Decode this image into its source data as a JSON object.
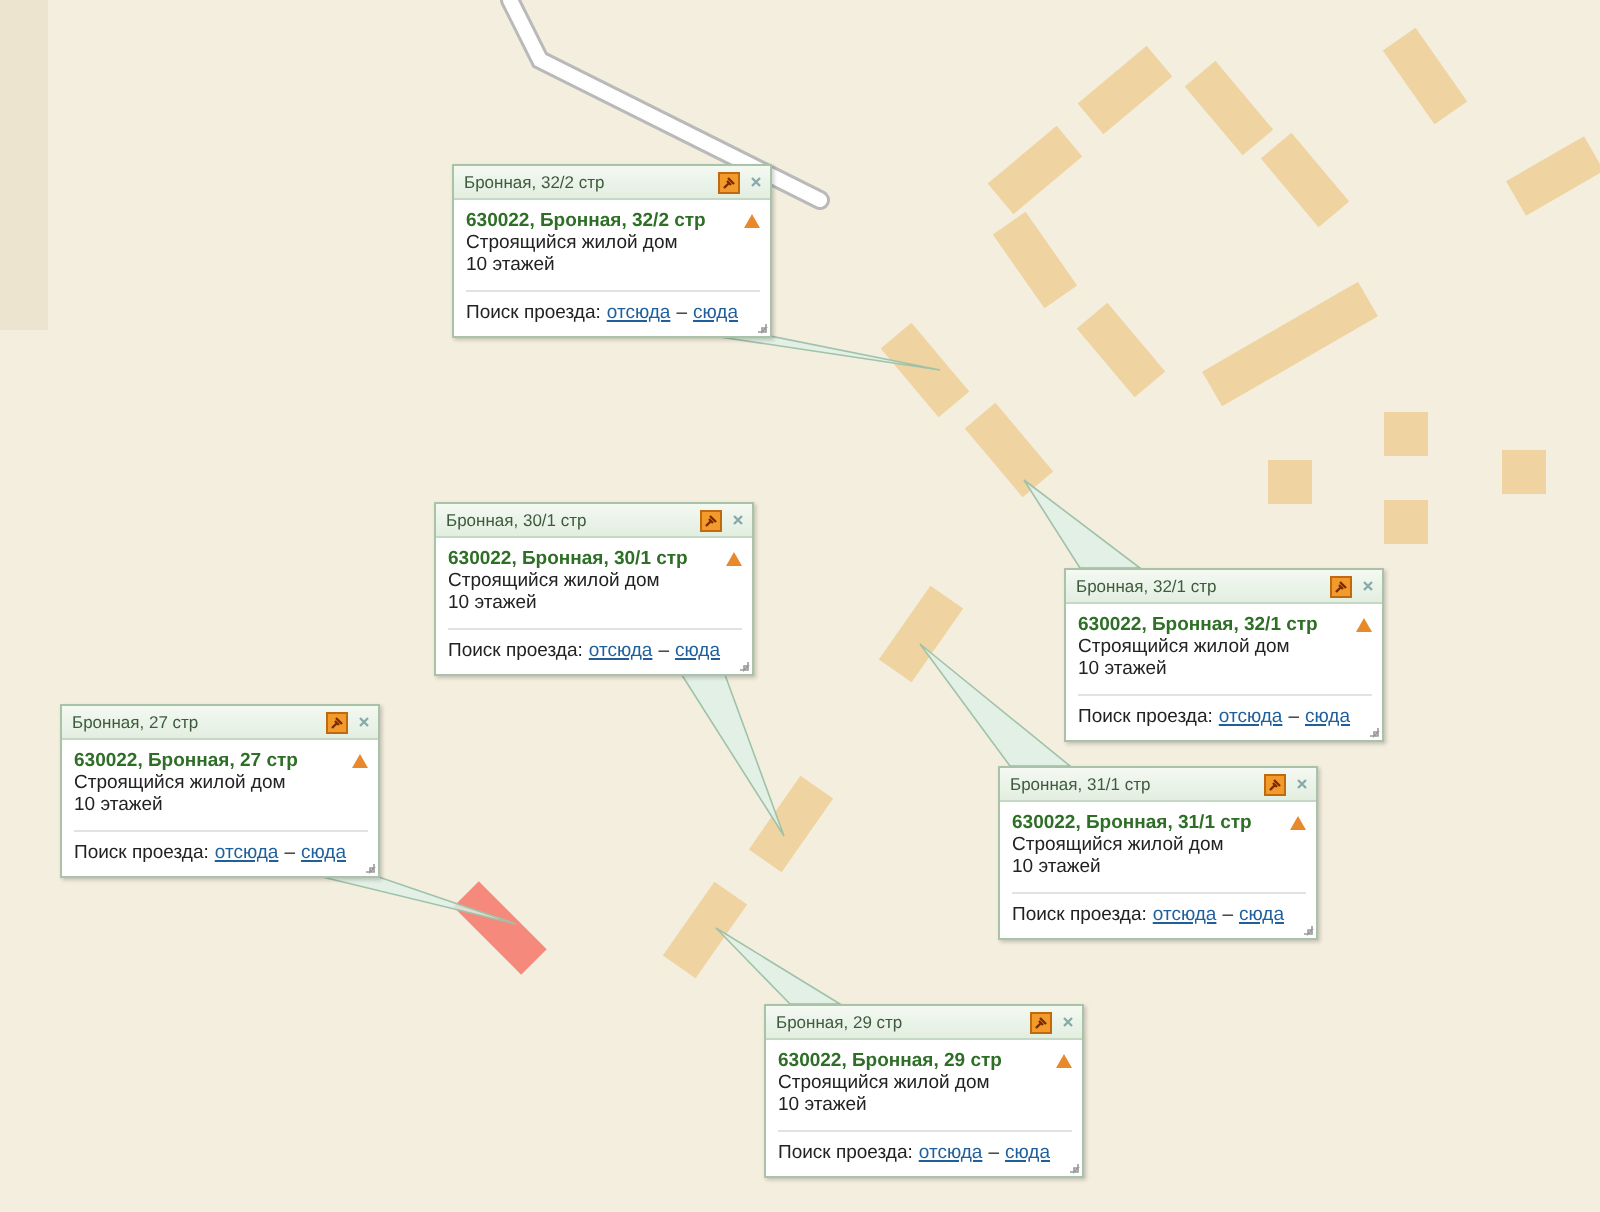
{
  "popups": [
    {
      "title": "Бронная, 32/2 стр",
      "address": "630022, Бронная, 32/2 стр",
      "description": "Строящийся жилой дом",
      "floors": "10 этажей",
      "route_label": "Поиск проезда:",
      "route_from": "отсюда",
      "route_dash": "–",
      "route_to": "сюда"
    },
    {
      "title": "Бронная, 30/1 стр",
      "address": "630022, Бронная, 30/1 стр",
      "description": "Строящийся жилой дом",
      "floors": "10 этажей",
      "route_label": "Поиск проезда:",
      "route_from": "отсюда",
      "route_dash": "–",
      "route_to": "сюда"
    },
    {
      "title": "Бронная, 27 стр",
      "address": "630022, Бронная, 27 стр",
      "description": "Строящийся жилой дом",
      "floors": "10 этажей",
      "route_label": "Поиск проезда:",
      "route_from": "отсюда",
      "route_dash": "–",
      "route_to": "сюда"
    },
    {
      "title": "Бронная, 32/1 стр",
      "address": "630022, Бронная, 32/1 стр",
      "description": "Строящийся жилой дом",
      "floors": "10 этажей",
      "route_label": "Поиск проезда:",
      "route_from": "отсюда",
      "route_dash": "–",
      "route_to": "сюда"
    },
    {
      "title": "Бронная, 31/1 стр",
      "address": "630022, Бронная, 31/1 стр",
      "description": "Строящийся жилой дом",
      "floors": "10 этажей",
      "route_label": "Поиск проезда:",
      "route_from": "отсюда",
      "route_dash": "–",
      "route_to": "сюда"
    },
    {
      "title": "Бронная, 29 стр",
      "address": "630022, Бронная, 29 стр",
      "description": "Строящийся жилой дом",
      "floors": "10 этажей",
      "route_label": "Поиск проезда:",
      "route_from": "отсюда",
      "route_dash": "–",
      "route_to": "сюда"
    }
  ]
}
